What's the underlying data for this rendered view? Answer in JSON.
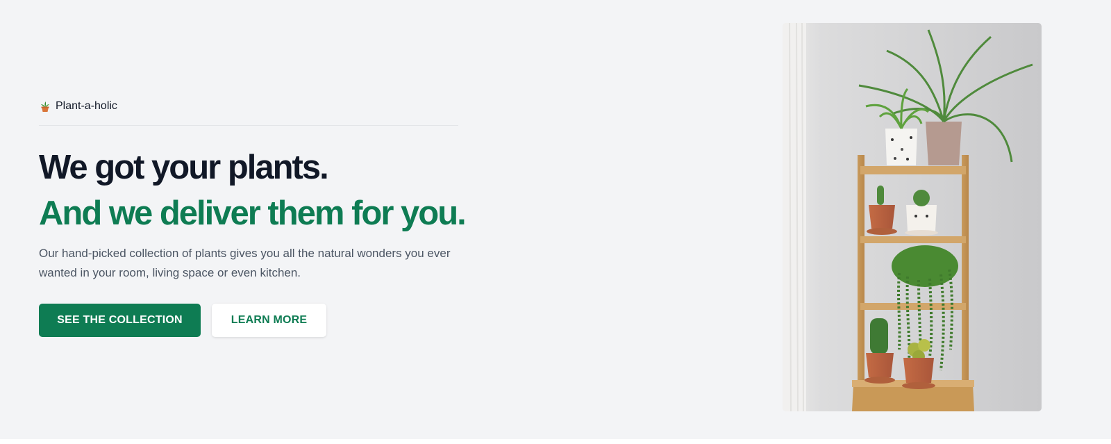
{
  "brand": {
    "icon": "potted-plant-icon",
    "name": "Plant-a-holic"
  },
  "hero": {
    "headline_line1": "We got your plants.",
    "headline_line2": "And we deliver them for you.",
    "description": "Our hand-picked collection of plants gives you all the natural wonders you ever wanted in your room, living space or even kitchen.",
    "primary_button": "SEE THE COLLECTION",
    "secondary_button": "LEARN MORE"
  },
  "image": {
    "alt": "Plants on a bamboo ladder shelf"
  },
  "colors": {
    "background": "#f3f4f6",
    "accent": "#0e7c53",
    "heading": "#111827",
    "body_text": "#4b5563"
  }
}
